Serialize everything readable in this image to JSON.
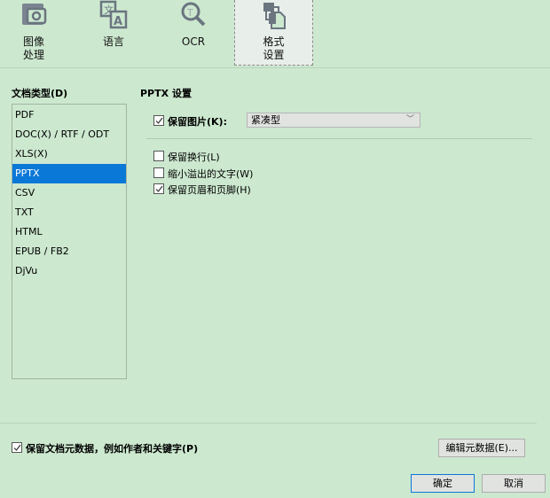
{
  "toolbar": {
    "items": [
      {
        "label_line1": "图像",
        "label_line2": "处理",
        "icon": "image-camera-icon"
      },
      {
        "label_line1": "语言",
        "label_line2": "",
        "icon": "language-icon"
      },
      {
        "label_line1": "OCR",
        "label_line2": "",
        "icon": "ocr-magnifier-icon"
      },
      {
        "label_line1": "格式",
        "label_line2": "设置",
        "icon": "format-settings-icon",
        "active": true
      }
    ]
  },
  "doc_types": {
    "title": "文档类型(D)",
    "items": [
      "PDF",
      "DOC(X) / RTF / ODT",
      "XLS(X)",
      "PPTX",
      "CSV",
      "TXT",
      "HTML",
      "EPUB / FB2",
      "DjVu"
    ],
    "selected": "PPTX"
  },
  "settings": {
    "title": "PPTX 设置",
    "keep_images": {
      "label": "保留图片(K):",
      "checked": true,
      "value": "紧凑型"
    },
    "options": [
      {
        "label": "保留换行(L)",
        "checked": false
      },
      {
        "label": "缩小溢出的文字(W)",
        "checked": false
      },
      {
        "label": "保留页眉和页脚(H)",
        "checked": true
      }
    ]
  },
  "footer": {
    "metadata_label": "保留文档元数据，例如作者和关键字(P)",
    "metadata_checked": true,
    "edit_metadata": "编辑元数据(E)...",
    "ok": "确定",
    "cancel": "取消"
  },
  "colors": {
    "background": "#cce8cf",
    "selection": "#0a78d7"
  }
}
